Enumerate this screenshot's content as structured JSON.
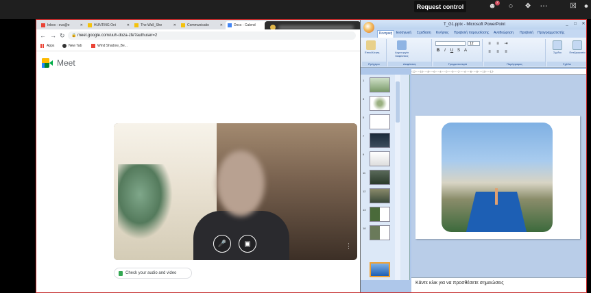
{
  "teams_bar": {
    "request_control_label": "Request control",
    "notification_count": "2",
    "icons": [
      "people-icon",
      "chat-icon",
      "share-icon",
      "more-icon",
      "camera-off-icon",
      "mic-icon"
    ]
  },
  "chrome": {
    "tabs": [
      {
        "label": "Inbox - eva@e",
        "icon": "gmail-icon"
      },
      {
        "label": "HUNTING Oni",
        "icon": "bookmark-icon"
      },
      {
        "label": "The Wall_She",
        "icon": "bookmark-icon"
      },
      {
        "label": "Communicatio",
        "icon": "bookmark-icon"
      },
      {
        "label": "Docs - Calend",
        "icon": "docs-icon"
      }
    ],
    "url": "meet.google.com/uuh-doza-zfe?authuser=2",
    "bookmarks": [
      {
        "label": "Apps",
        "icon": "apps-grid-icon"
      },
      {
        "label": "New Tab",
        "icon": "globe-icon"
      },
      {
        "label": "Wind Shadow_Be...",
        "icon": "gmail-icon"
      }
    ]
  },
  "meet": {
    "title": "Meet",
    "check_audio_label": "Check your audio and video"
  },
  "powerpoint": {
    "window_title": "T_G1.pptx - Microsoft PowerPoint",
    "ribbon_tabs": [
      "Κεντρική",
      "Εισαγωγή",
      "Σχεδίαση",
      "Κινήσεις",
      "Προβολή παρουσίασης",
      "Αναθεώρηση",
      "Προβολή",
      "Προγραμματιστής"
    ],
    "groups": [
      "Πρόχειρο",
      "Διαφάνειες",
      "Γραμματοσειρά",
      "Παράγραφος",
      "Σχέδιο"
    ],
    "buttons": [
      "Επικόλληση",
      "Δημιουργία διαφάνειας",
      "Σχέδιο",
      "Επεξεργασία"
    ],
    "font_size": "12",
    "ruler_text": "·12·····10·····8·····6·····4·····2·····0·····2·····4·····6·····8·····10·····12·",
    "slide_numbers": [
      "1",
      "3",
      "5",
      "7",
      "9",
      "11",
      "12",
      "13",
      "18"
    ],
    "notes_placeholder": "Κάντε κλικ για να προσθέσετε σημειώσεις"
  },
  "colors": {
    "share_border": "#c42b2b",
    "teams_bar_bg": "#1f1f1f",
    "ppt_blue": "#aec7ea"
  }
}
